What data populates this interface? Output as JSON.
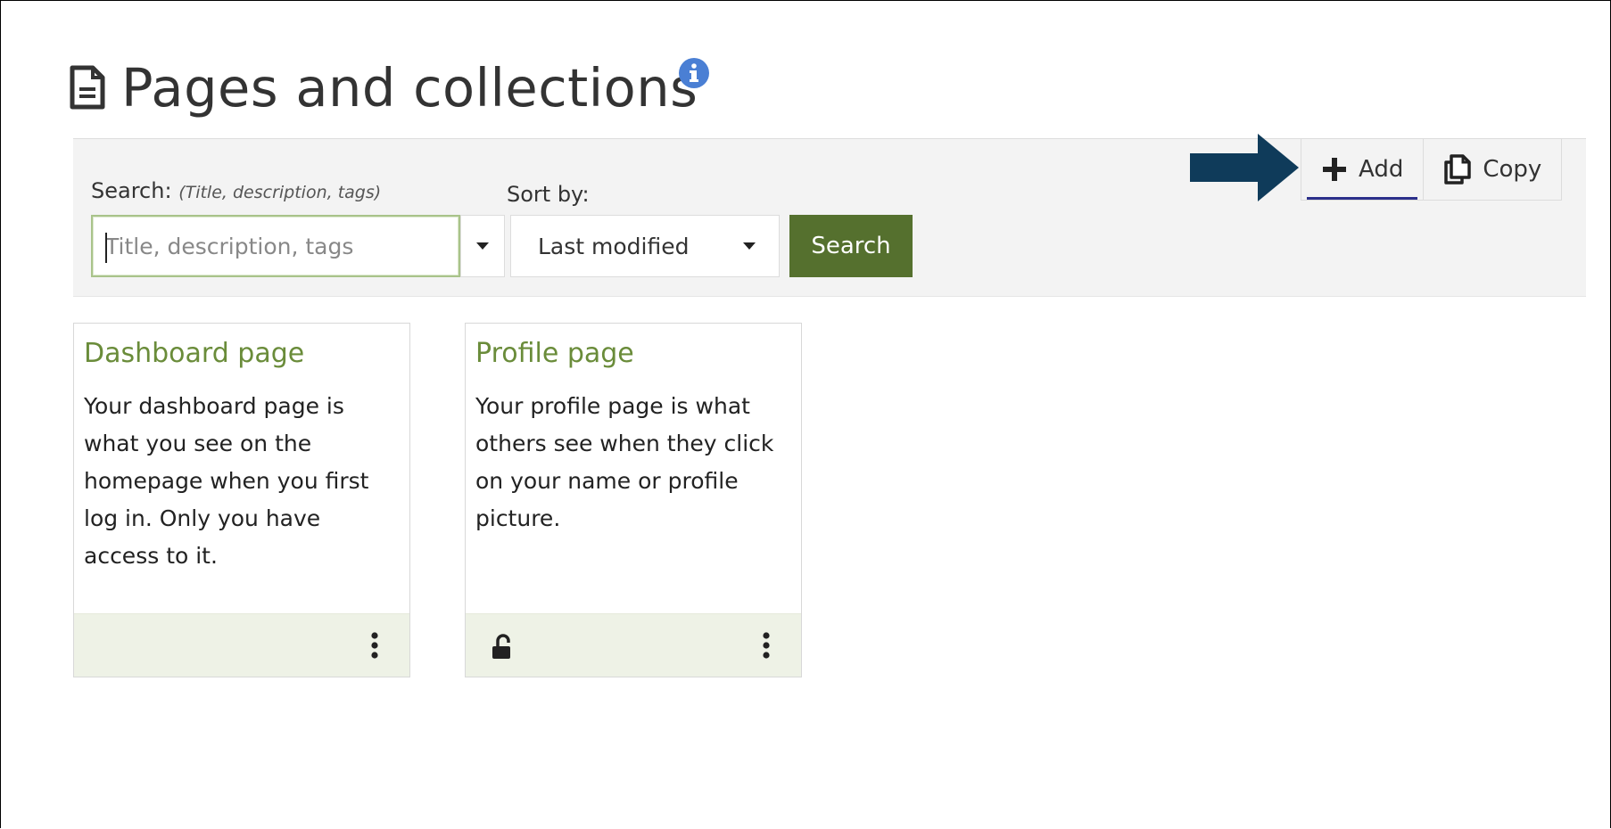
{
  "heading": {
    "title": "Pages and collections",
    "doc_icon": "document-icon",
    "info_icon": "info-icon"
  },
  "toolbar": {
    "search_label": "Search:",
    "search_hint": "(Title, description, tags)",
    "search_placeholder": "Title, description, tags",
    "search_value": "",
    "sort_label": "Sort by:",
    "sort_value": "Last modified",
    "search_button": "Search"
  },
  "actions": {
    "add_label": "Add",
    "copy_label": "Copy"
  },
  "cards": [
    {
      "title": "Dashboard page",
      "description": "Your dashboard page is what you see on the homepage when you first log in. Only you have access to it."
    },
    {
      "title": "Profile page",
      "description": "Your profile page is what others see when they click on your name or profile picture."
    }
  ],
  "colors": {
    "accent_green": "#55702e",
    "card_title_green": "#6a8c3a",
    "arrow_navy": "#0f3b5a",
    "info_blue": "#4a7fd4"
  }
}
